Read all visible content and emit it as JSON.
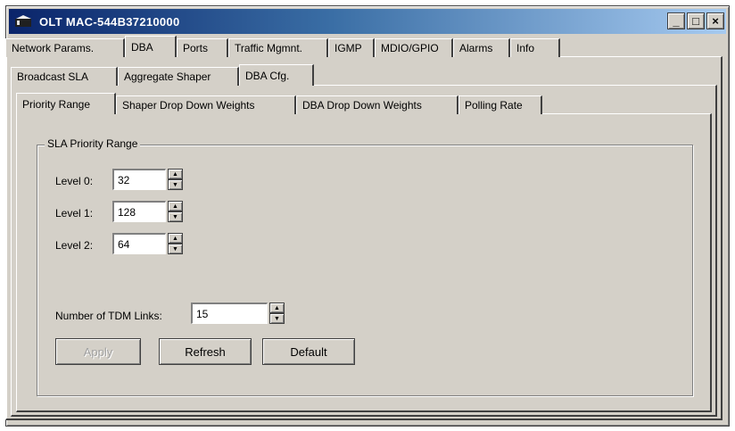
{
  "window": {
    "title": "OLT MAC-544B37210000",
    "minimize": "_",
    "maximize": "□",
    "close": "×"
  },
  "main_tabs": [
    "Network Params.",
    "DBA",
    "Ports",
    "Traffic Mgmnt.",
    "IGMP",
    "MDIO/GPIO",
    "Alarms",
    "Info"
  ],
  "dba_tabs": [
    "Broadcast SLA",
    "Aggregate Shaper",
    "DBA Cfg."
  ],
  "cfg_tabs": [
    "Priority Range",
    "Shaper Drop Down Weights",
    "DBA Drop Down Weights",
    "Polling Rate"
  ],
  "sla_priority_range": {
    "legend": "SLA Priority Range",
    "levels": [
      {
        "label": "Level 0:",
        "value": "32"
      },
      {
        "label": "Level 1:",
        "value": "128"
      },
      {
        "label": "Level 2:",
        "value": "64"
      }
    ]
  },
  "tdm": {
    "label": "Number of TDM Links:",
    "value": "15"
  },
  "buttons": {
    "apply": "Apply",
    "refresh": "Refresh",
    "default": "Default"
  },
  "colors": {
    "titlebar_start": "#0a246a",
    "titlebar_end": "#a6caf0",
    "face": "#d4d0c8"
  },
  "icons": {
    "app": "app-icon",
    "spin_up": "spin-up-arrow-icon",
    "spin_down": "spin-down-arrow-icon"
  }
}
